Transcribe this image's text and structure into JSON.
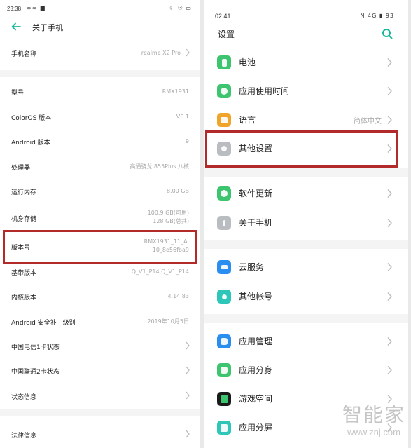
{
  "left": {
    "status_time": "23:38",
    "status_signal": "∞∞ ■",
    "status_right": "☾ ☉ ▭",
    "title": "关于手机",
    "rows": [
      {
        "label": "手机名称",
        "value": "realme X2 Pro"
      },
      {
        "label": "型号",
        "value": "RMX1931"
      },
      {
        "label": "ColorOS 版本",
        "value": "V6.1"
      },
      {
        "label": "Android 版本",
        "value": "9"
      },
      {
        "label": "处理器",
        "value": "高通骁龙 855Plus 八核"
      },
      {
        "label": "运行内存",
        "value": "8.00 GB"
      },
      {
        "label": "机身存储",
        "value": "100.9 GB(可用)",
        "value2": "128 GB(总共)"
      },
      {
        "label": "版本号",
        "value": "RMX1931_11_A.",
        "value2": "10_8e56fba9"
      },
      {
        "label": "基带版本",
        "value": "Q_V1_P14,Q_V1_P14"
      },
      {
        "label": "内核版本",
        "value": "4.14.83"
      },
      {
        "label": "Android 安全补丁级别",
        "value": "2019年10月5日"
      },
      {
        "label": "中国电信1卡状态"
      },
      {
        "label": "中国联通2卡状态"
      },
      {
        "label": "状态信息"
      },
      {
        "label": "法律信息"
      }
    ]
  },
  "right": {
    "status_time": "02:41",
    "status_right": "N 4G ▮ 93",
    "title": "设置",
    "rows": [
      {
        "label": "电池",
        "icon": "battery-icon",
        "color": "#3cc46e"
      },
      {
        "label": "应用使用时间",
        "icon": "app-usage-icon",
        "color": "#3cc46e"
      },
      {
        "label": "语言",
        "value": "简体中文",
        "icon": "language-icon",
        "color": "#f0a42a"
      },
      {
        "label": "其他设置",
        "icon": "other-settings-icon",
        "color": "#b9bcc0"
      },
      {
        "label": "软件更新",
        "icon": "software-update-icon",
        "color": "#3cc46e"
      },
      {
        "label": "关于手机",
        "icon": "about-phone-icon",
        "color": "#b9bcc0"
      },
      {
        "label": "云服务",
        "icon": "cloud-icon",
        "color": "#2a8ef0"
      },
      {
        "label": "其他帐号",
        "icon": "account-icon",
        "color": "#2ec6b8"
      },
      {
        "label": "应用管理",
        "icon": "app-manage-icon",
        "color": "#2a8ef0"
      },
      {
        "label": "应用分身",
        "icon": "app-clone-icon",
        "color": "#3cc46e"
      },
      {
        "label": "游戏空间",
        "icon": "game-space-icon",
        "color": "#1a1a1a"
      },
      {
        "label": "应用分屏",
        "icon": "split-screen-icon",
        "color": "#2ec6b8"
      }
    ]
  },
  "watermark": {
    "big": "智能家",
    "small": "www.znj.com"
  },
  "colors": {
    "accent": "#18b79b",
    "highlight": "#b22a2a"
  }
}
